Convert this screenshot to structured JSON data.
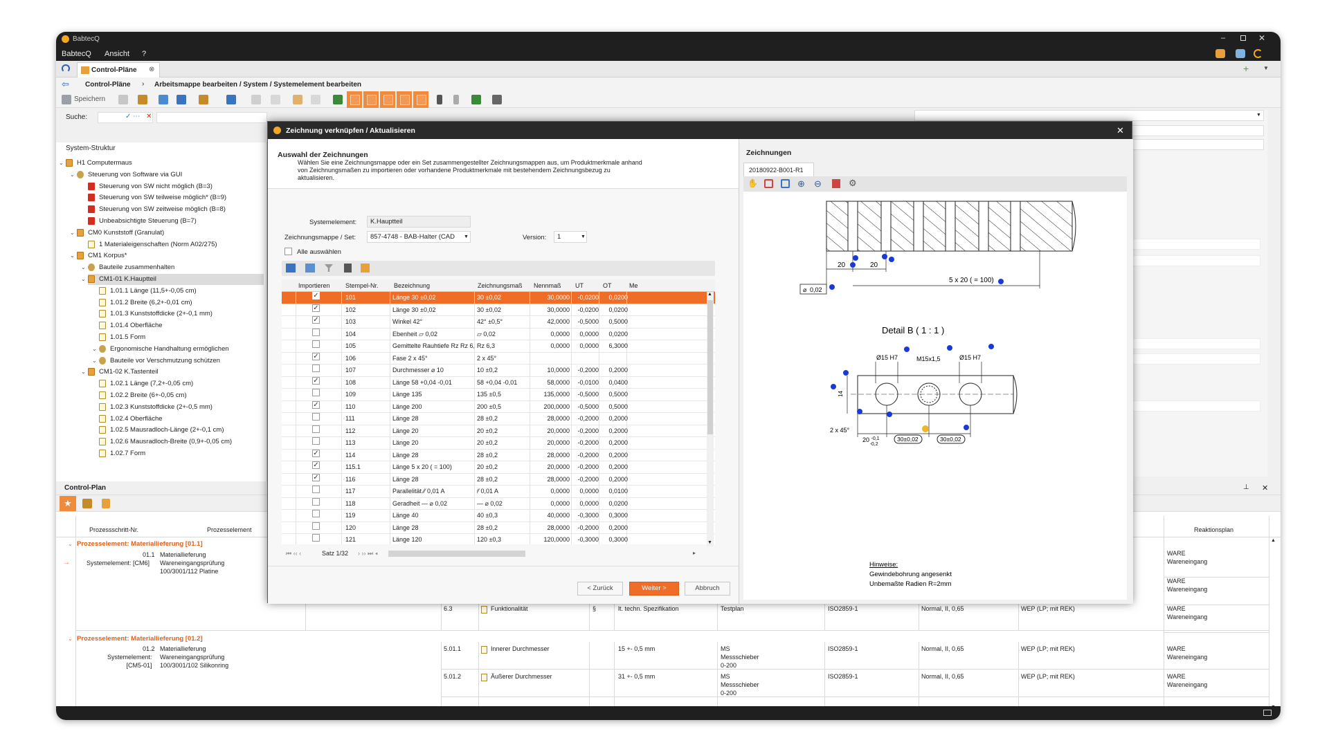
{
  "window": {
    "title": "BabtecQ"
  },
  "menu": [
    "BabtecQ",
    "Ansicht",
    "?"
  ],
  "tab": {
    "label": "Control-Pläne"
  },
  "breadcrumb": {
    "root": "Control-Pläne",
    "path": "Arbeitsmappe bearbeiten / System / Systemelement bearbeiten"
  },
  "toolbar": {
    "save_label": "Speichern"
  },
  "search": {
    "label": "Suche:"
  },
  "tree": {
    "header": "System-Struktur",
    "items": [
      {
        "label": "H1 Computermaus",
        "icon": "folder",
        "level": 1
      },
      {
        "label": "Steuerung von Software via GUI",
        "icon": "gear",
        "level": 2
      },
      {
        "label": "Steuerung von SW nicht möglich (B=3)",
        "icon": "red",
        "level": 3
      },
      {
        "label": "Steuerung von SW teilweise möglich* (B=9)",
        "icon": "red",
        "level": 3
      },
      {
        "label": "Steuerung von SW zeitweise möglich (B=8)",
        "icon": "red",
        "level": 3
      },
      {
        "label": "Unbeabsichtigte Steuerung (B=7)",
        "icon": "red",
        "level": 3
      },
      {
        "label": "CM0 Kunststoff (Granulat)",
        "icon": "folder",
        "level": 2
      },
      {
        "label": "1 Materialeigenschaften (Norm A02/275)",
        "icon": "doc",
        "level": 3
      },
      {
        "label": "CM1 Korpus*",
        "icon": "folder",
        "level": 2
      },
      {
        "label": "Bauteile zusammenhalten",
        "icon": "gear",
        "level": 3
      },
      {
        "label": "CM1-01 K.Hauptteil",
        "icon": "folder",
        "level": 3,
        "selected": true
      },
      {
        "label": "1.01.1 Länge (11,5+-0,05 cm)",
        "icon": "doc",
        "level": 4
      },
      {
        "label": "1.01.2 Breite (6,2+-0,01 cm)",
        "icon": "doc",
        "level": 4
      },
      {
        "label": "1.01.3 Kunststoffdicke (2+-0,1 mm)",
        "icon": "doc",
        "level": 4
      },
      {
        "label": "1.01.4 Oberfläche",
        "icon": "doc",
        "level": 4
      },
      {
        "label": "1.01.5 Form",
        "icon": "doc",
        "level": 4
      },
      {
        "label": "Ergonomische Handhaltung ermöglichen",
        "icon": "gear",
        "level": 4
      },
      {
        "label": "Bauteile vor Verschmutzung schützen",
        "icon": "gear",
        "level": 4
      },
      {
        "label": "CM1-02 K.Tastenteil",
        "icon": "folder",
        "level": 3
      },
      {
        "label": "1.02.1 Länge (7,2+-0,05 cm)",
        "icon": "doc",
        "level": 4
      },
      {
        "label": "1.02.2 Breite (6+-0,05 cm)",
        "icon": "doc",
        "level": 4
      },
      {
        "label": "1.02.3 Kunststoffdicke (2+-0,5 mm)",
        "icon": "doc",
        "level": 4
      },
      {
        "label": "1.02.4 Oberfläche",
        "icon": "doc",
        "level": 4
      },
      {
        "label": "1.02.5 Mausradloch-Länge (2+-0,1 cm)",
        "icon": "doc",
        "level": 4
      },
      {
        "label": "1.02.6 Mausradloch-Breite (0,9+-0,05 cm)",
        "icon": "doc",
        "level": 4
      },
      {
        "label": "1.02.7 Form",
        "icon": "doc",
        "level": 4
      }
    ]
  },
  "controlplan": {
    "title": "Control-Plan",
    "headers": {
      "step": "Prozessschritt-Nr.",
      "element": "Prozesselement",
      "reaction": "Reaktionsplan"
    },
    "groups": [
      {
        "title": "Prozesselement: Materiallieferung [01.1]",
        "num": "01.1",
        "sys": "Systemelement: [CM6]",
        "desc": "Materiallieferung\nWareneingangsprüfung\n100/3001/112 Platine",
        "rows": [
          {
            "reaction": "WARE\nWareneingang"
          },
          {
            "reaction": "WARE\nWareneingang"
          },
          {
            "nr": "6.3",
            "feature": "Funktionalität",
            "sym": "§",
            "spec": "lt. techn. Spezifikation",
            "method": "Testplan",
            "norm": "ISO2859-1",
            "level": "Normal, II, 0,65",
            "plan": "WEP (LP; mit REK)",
            "reaction": "WARE\nWareneingang"
          }
        ]
      },
      {
        "title": "Prozesselement: Materiallieferung [01.2]",
        "num": "01.2",
        "sys": "Systemelement:\n[CM5-01]",
        "desc": "Materiallieferung\nWareneingangsprüfung\n100/3001/102 Silikonring",
        "rows": [
          {
            "nr": "5.01.1",
            "feature": "Innerer Durchmesser",
            "spec": "15 +- 0,5 mm",
            "method": "MS\nMessschieber\n0-200",
            "norm": "ISO2859-1",
            "level": "Normal, II, 0,65",
            "plan": "WEP (LP; mit REK)",
            "reaction": "WARE\nWareneingang"
          },
          {
            "nr": "5.01.2",
            "feature": "Äußerer Durchmesser",
            "spec": "31 +- 0,5 mm",
            "method": "MS\nMessschieber\n0-200",
            "norm": "ISO2859-1",
            "level": "Normal, II, 0,65",
            "plan": "WEP (LP; mit REK)",
            "reaction": "WARE\nWareneingang"
          }
        ]
      }
    ]
  },
  "dialog": {
    "title": "Zeichnung verknüpfen / Aktualisieren",
    "heading": "Auswahl der Zeichnungen",
    "description": [
      "Wählen Sie eine Zeichnungsmappe oder ein Set zusammengestellter Zeichnungsmappen aus, um Produktmerkmale anhand",
      "von Zeichnungsmaßen zu importieren oder vorhandene Produktmerkmale mit bestehendem Zeichnungsbezug zu",
      "aktualisieren."
    ],
    "system_label": "Systemelement:",
    "system_value": "K.Hauptteil",
    "mappe_label": "Zeichnungsmappe / Set:",
    "mappe_value": "857-4748 - BAB-Halter (CAD",
    "version_label": "Version:",
    "version_value": "1",
    "select_all": "Alle auswählen",
    "columns": [
      "Importieren",
      "Stempel-Nr.",
      "Bezeichnung",
      "Zeichnungsmaß",
      "Nennmaß",
      "UT",
      "OT",
      "Me"
    ],
    "rows": [
      {
        "chk": true,
        "nr": "101",
        "bez": "Länge 30 ±0,02",
        "zm": "30 ±0,02",
        "nm": "30,0000",
        "ut": "-0,0200",
        "ot": "0,0200",
        "sel": true
      },
      {
        "chk": true,
        "nr": "102",
        "bez": "Länge 30 ±0,02",
        "zm": "30 ±0,02",
        "nm": "30,0000",
        "ut": "-0,0200",
        "ot": "0,0200"
      },
      {
        "chk": true,
        "nr": "103",
        "bez": "Winkel 42°",
        "zm": "42° ±0,5°",
        "nm": "42,0000",
        "ut": "-0,5000",
        "ot": "0,5000"
      },
      {
        "chk": false,
        "nr": "104",
        "bez": "Ebenheit ▱ 0,02",
        "zm": "▱ 0,02",
        "nm": "0,0000",
        "ut": "0,0000",
        "ot": "0,0200"
      },
      {
        "chk": false,
        "nr": "105",
        "bez": "Gemittelte Rauhtiefe Rz Rz 6,3",
        "zm": "Rz 6,3",
        "nm": "0,0000",
        "ut": "0,0000",
        "ot": "6,3000"
      },
      {
        "chk": true,
        "nr": "106",
        "bez": "Fase 2 x 45°",
        "zm": "2 x 45°",
        "nm": "",
        "ut": "",
        "ot": ""
      },
      {
        "chk": false,
        "nr": "107",
        "bez": "Durchmesser ⌀ 10",
        "zm": "10 ±0,2",
        "nm": "10,0000",
        "ut": "-0,2000",
        "ot": "0,2000"
      },
      {
        "chk": true,
        "nr": "108",
        "bez": "Länge 58 +0,04 -0,01",
        "zm": "58 +0,04 -0,01",
        "nm": "58,0000",
        "ut": "-0,0100",
        "ot": "0,0400"
      },
      {
        "chk": false,
        "nr": "109",
        "bez": "Länge 135",
        "zm": "135 ±0,5",
        "nm": "135,0000",
        "ut": "-0,5000",
        "ot": "0,5000"
      },
      {
        "chk": true,
        "nr": "110",
        "bez": "Länge 200",
        "zm": "200 ±0,5",
        "nm": "200,0000",
        "ut": "-0,5000",
        "ot": "0,5000"
      },
      {
        "chk": false,
        "nr": "111",
        "bez": "Länge 28",
        "zm": "28 ±0,2",
        "nm": "28,0000",
        "ut": "-0,2000",
        "ot": "0,2000"
      },
      {
        "chk": false,
        "nr": "112",
        "bez": "Länge 20",
        "zm": "20 ±0,2",
        "nm": "20,0000",
        "ut": "-0,2000",
        "ot": "0,2000"
      },
      {
        "chk": false,
        "nr": "113",
        "bez": "Länge 20",
        "zm": "20 ±0,2",
        "nm": "20,0000",
        "ut": "-0,2000",
        "ot": "0,2000"
      },
      {
        "chk": true,
        "nr": "114",
        "bez": "Länge 28",
        "zm": "28 ±0,2",
        "nm": "28,0000",
        "ut": "-0,2000",
        "ot": "0,2000"
      },
      {
        "chk": true,
        "nr": "115.1",
        "bez": "Länge 5 x 20 ( = 100)",
        "zm": "20 ±0,2",
        "nm": "20,0000",
        "ut": "-0,2000",
        "ot": "0,2000"
      },
      {
        "chk": true,
        "nr": "116",
        "bez": "Länge 28",
        "zm": "28 ±0,2",
        "nm": "28,0000",
        "ut": "-0,2000",
        "ot": "0,2000"
      },
      {
        "chk": false,
        "nr": "117",
        "bez": "Parallelität ⁄⁄ 0,01 A",
        "zm": "⁄⁄ 0,01 A",
        "nm": "0,0000",
        "ut": "0,0000",
        "ot": "0,0100"
      },
      {
        "chk": false,
        "nr": "118",
        "bez": "Geradheit — ⌀ 0,02",
        "zm": "— ⌀ 0,02",
        "nm": "0,0000",
        "ut": "0,0000",
        "ot": "0,0200"
      },
      {
        "chk": false,
        "nr": "119",
        "bez": "Länge 40",
        "zm": "40 ±0,3",
        "nm": "40,0000",
        "ut": "-0,3000",
        "ot": "0,3000"
      },
      {
        "chk": false,
        "nr": "120",
        "bez": "Länge 28",
        "zm": "28 ±0,2",
        "nm": "28,0000",
        "ut": "-0,2000",
        "ot": "0,2000"
      },
      {
        "chk": false,
        "nr": "121",
        "bez": "Länge 120",
        "zm": "120 ±0,3",
        "nm": "120,0000",
        "ut": "-0,3000",
        "ot": "0,3000"
      }
    ],
    "record_label": "Satz 1/32",
    "back_label": "< Zurück",
    "next_label": "Weiter >",
    "cancel_label": "Abbruch",
    "drawings_title": "Zeichnungen",
    "drawing_tab": "20180922-B001-R1",
    "drawing": {
      "dim_20a": "20",
      "dim_20b": "20",
      "dim_5x20": "5 x 20 ( = 100)",
      "flat": "0,02",
      "detail": "Detail B ( 1 : 1 )",
      "d15a": "Ø15 H7",
      "m15": "M15x1,5",
      "d15b": "Ø15 H7",
      "fase": "2 x 45°",
      "tol": "20 -0,1\n   -0,2",
      "box1": "30±0,02",
      "box2": "30±0,02",
      "side": "14",
      "notes_title": "Hinweise:",
      "note1": "Gewindebohrung angesenkt",
      "note2": "Unbemaßte Radien R=2mm"
    }
  },
  "colors": {
    "accent": "#f06d27",
    "titlebar": "#1f1f1f"
  }
}
